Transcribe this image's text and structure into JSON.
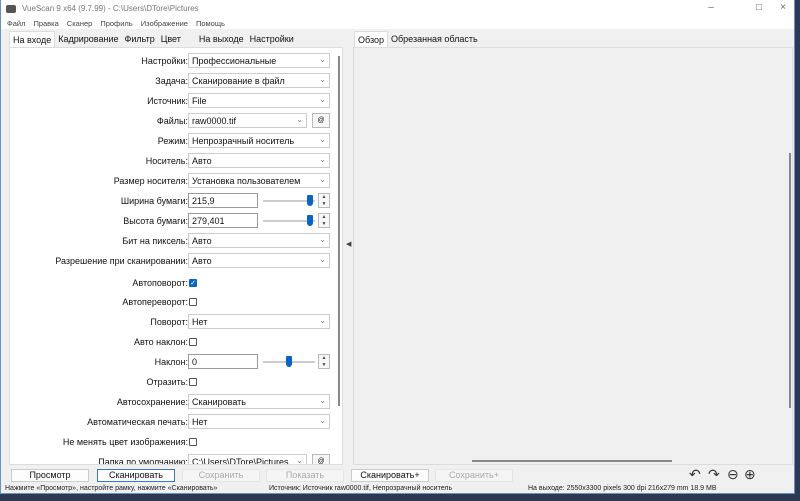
{
  "window": {
    "title": "VueScan 9 x64 (9.7.99) - C:\\Users\\DTore\\Pictures"
  },
  "menu": [
    "Файл",
    "Правка",
    "Сканер",
    "Профиль",
    "Изображение",
    "Помощь"
  ],
  "left_tabs": [
    "На входе",
    "Кадрирование",
    "Фильтр",
    "Цвет",
    "На выходе",
    "Настройки"
  ],
  "right_tabs": [
    "Обзор",
    "Обрезанная область"
  ],
  "form": {
    "settings": {
      "label": "Настройки:",
      "value": "Профессиональные"
    },
    "task": {
      "label": "Задача:",
      "value": "Сканирование в файл"
    },
    "source": {
      "label": "Источник:",
      "value": "File"
    },
    "files": {
      "label": "Файлы:",
      "value": "raw0000.tif",
      "button": "@"
    },
    "mode": {
      "label": "Режим:",
      "value": "Непрозрачный носитель"
    },
    "media": {
      "label": "Носитель:",
      "value": "Авто"
    },
    "media_size": {
      "label": "Размер носителя:",
      "value": "Установка пользователем"
    },
    "paper_width": {
      "label": "Ширина бумаги:",
      "value": "215,9",
      "slider": 0.9
    },
    "paper_height": {
      "label": "Высота бумаги:",
      "value": "279,401",
      "slider": 0.9
    },
    "bits": {
      "label": "Бит на пиксель:",
      "value": "Авто"
    },
    "resolution": {
      "label": "Разрешение при сканировании:",
      "value": "Авто"
    },
    "autorotate": {
      "label": "Автоповорот:",
      "checked": true
    },
    "autoflip": {
      "label": "Автопереворот:",
      "checked": false
    },
    "rotation": {
      "label": "Поворот:",
      "value": "Нет"
    },
    "autoskew": {
      "label": "Авто наклон:",
      "checked": false
    },
    "skew": {
      "label": "Наклон:",
      "value": "0",
      "slider": 0.5
    },
    "mirror": {
      "label": "Отразить:",
      "checked": false
    },
    "autosave": {
      "label": "Автосохранение:",
      "value": "Сканировать"
    },
    "autoprint": {
      "label": "Автоматическая печать:",
      "value": "Нет"
    },
    "keep_color": {
      "label": "Не менять цвет изображения:",
      "checked": false
    },
    "default_folder": {
      "label": "Папка по умолчанию:",
      "value": "C:\\Users\\DTore\\Pictures",
      "button": "@"
    }
  },
  "buttons": {
    "preview": "Просмотр",
    "scan": "Сканировать",
    "save": "Сохранить",
    "show": "Показать",
    "scan_plus": "Сканировать+",
    "save_plus": "Сохранить+"
  },
  "status": {
    "left": "Нажмите «Просмотр», настройте рамку, нажмите «Сканировать»",
    "middle": "Источник: Источник raw0000.tif, Непрозрачный носитель",
    "right": "На выходе: 2550x3300 pixels 300 dpi 216x279 mm 18.9 MB"
  }
}
